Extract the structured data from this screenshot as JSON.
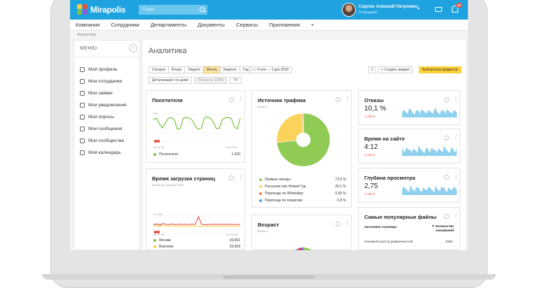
{
  "app": {
    "name": "Mirapolis",
    "search_placeholder": "Поиск",
    "user_name": "Сергин Алексей Петрович",
    "user_role": "Сотрудник",
    "notifications_count": "29"
  },
  "nav": [
    "Компания",
    "Сотрудники",
    "Департаменты",
    "Документы",
    "Сервисы",
    "Приложения",
    "+"
  ],
  "breadcrumb": "Аналитика",
  "sidebar": {
    "title": "МЕНЮ",
    "items": [
      {
        "label": "Мой профиль"
      },
      {
        "label": "Мои сотрудники"
      },
      {
        "label": "Мои заявки"
      },
      {
        "label": "Мои уведомления"
      },
      {
        "label": "Мои опросы"
      },
      {
        "label": "Мои сообщения"
      },
      {
        "label": "Мои сообщества"
      },
      {
        "label": "Мой календарь"
      }
    ]
  },
  "page": {
    "title": "Аналитика"
  },
  "toolbar": {
    "periods": [
      "Сегодня",
      "Вчера",
      "Неделя",
      "Месяц",
      "Квартал",
      "Год"
    ],
    "active_period": "Месяц",
    "date_range": "4 ноя — 3 дек 2018",
    "add_widget": "+ Создать виджет",
    "library": "Библиотека виджетов",
    "detail_label": "Детализация: по дням",
    "accuracy_label": "Точность: 100%",
    "ratio_label": "7/7"
  },
  "visitors": {
    "title": "Посетители",
    "y_top": "800",
    "x_start": "04.11.18",
    "x_end": "03.12.18",
    "legend": [
      {
        "name": "Посетители",
        "value": "1 620",
        "color": "#7cc142"
      }
    ],
    "series": [
      650,
      700,
      540,
      420,
      560,
      700,
      720,
      650,
      380,
      410,
      700,
      720,
      700,
      640,
      470,
      380,
      420,
      700,
      740,
      700,
      590,
      400,
      410,
      660,
      710,
      720,
      690,
      450,
      390,
      700
    ]
  },
  "load": {
    "title": "Время загрузки страниц",
    "subtitle": "Время до загрузки DOM",
    "y_top": "20,000",
    "y_mid": "10,000",
    "x_start": "04.11.18",
    "x_end": "03.12.18",
    "legend": [
      {
        "name": "Москва",
        "value": "03,831",
        "color": "#7cc142"
      },
      {
        "name": "Воронеж",
        "value": "03,659",
        "color": "#fcd034"
      }
    ],
    "series_red": [
      9500,
      10500,
      9000,
      11000,
      10000,
      9800,
      10500,
      9600,
      10300,
      9900,
      10200,
      9700,
      10400,
      9900,
      18500,
      10000,
      9600,
      10100,
      9900,
      10300,
      9800,
      10000,
      10200,
      9900,
      10100,
      10000,
      9800,
      10100
    ],
    "series_yellow": [
      8000,
      8500,
      7800,
      8800,
      8200,
      7900,
      8600,
      8100,
      8400,
      7800,
      8300,
      8000,
      8500,
      7900,
      8200,
      8100,
      7700,
      8400,
      8000,
      8300,
      7800,
      8200,
      8100,
      7900,
      8300,
      8000,
      7900,
      8200
    ]
  },
  "traffic": {
    "title": "Источник трафика",
    "subtitle": "Визиты",
    "legend": [
      {
        "name": "Прямые заходы",
        "value": "73,5 %",
        "color": "#8fcb55"
      },
      {
        "name": "Рассылка про Новый Год",
        "value": "26,1 %",
        "color": "#fbd35a"
      },
      {
        "name": "Переходы по WhatsApp",
        "value": "0,56 %",
        "color": "#e8823a"
      },
      {
        "name": "Переходы по плакатам",
        "value": "0,0 %",
        "color": "#5b9bd5"
      }
    ],
    "slices": [
      73.5,
      26.1,
      0.56,
      0.01
    ]
  },
  "age": {
    "title": "Возраст",
    "subtitle": "Визиты"
  },
  "bounce": {
    "title": "Отказы",
    "value": "10,1 %",
    "delta": "-1,18 %"
  },
  "time_on_site": {
    "title": "Время на сайте",
    "value": "4:12",
    "delta": "-1,15 %"
  },
  "depth": {
    "title": "Глубина просмотра",
    "value": "2,75",
    "delta": "-1,18 %"
  },
  "files": {
    "title": "Самые популярные файлы",
    "col1": "Заголовок страницы",
    "col2_a": "▼ Количество",
    "col2_b": "скачиваний",
    "row_title": "Основной реестр доверенностей",
    "row_value": "2056"
  },
  "colors": {
    "accent": "#1fa3e0",
    "green": "#7cc142",
    "yellow": "#fcd034",
    "red": "#e2443c",
    "spark": "#8fd0ef"
  }
}
